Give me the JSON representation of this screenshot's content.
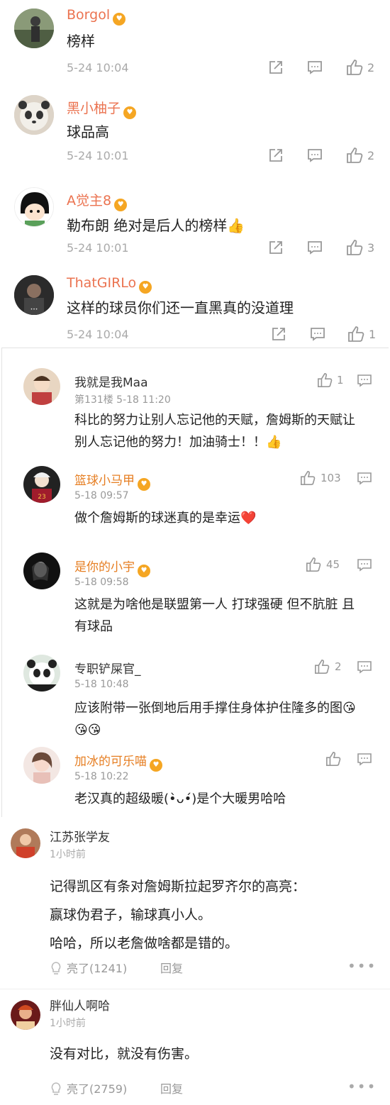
{
  "weibo": {
    "comments": [
      {
        "user": "Borgol",
        "text": "榜样",
        "time": "5-24 10:04",
        "likes": "2"
      },
      {
        "user": "黑小柚子",
        "text": "球品高",
        "time": "5-24 10:01",
        "likes": "2"
      },
      {
        "user": "A觉主8",
        "text": "勒布朗 绝对是后人的榜样👍",
        "time": "5-24 10:01",
        "likes": "3"
      },
      {
        "user": "ThatGIRLo",
        "text": "这样的球员你们还一直黑真的没道理",
        "time": "5-24 10:04",
        "likes": "1"
      }
    ]
  },
  "tieba": {
    "comments": [
      {
        "user": "我就是我Maa",
        "meta": "第131楼 5-18 11:20",
        "text": "科比的努力让别人忘记他的天赋，詹姆斯的天赋让别人忘记他的努力！加油骑士！！👍",
        "likes": "1"
      },
      {
        "user": "篮球小马甲",
        "meta": "5-18 09:57",
        "text": "做个詹姆斯的球迷真的是幸运❤️",
        "likes": "103"
      },
      {
        "user": "是你的小宇",
        "meta": "5-18 09:58",
        "text": "这就是为啥他是联盟第一人 打球强硬 但不肮脏 且有球品",
        "likes": "45"
      },
      {
        "user": "专职铲屎官_",
        "meta": "5-18 10:48",
        "text": "应该附带一张倒地后用手撑住身体护住隆多的图😘😘😘",
        "likes": "2"
      },
      {
        "user": "加冰的可乐喵",
        "meta": "5-18 10:22",
        "text": "老汉真的超级暖(•̀ᴗ•́)是个大暖男哈哈",
        "likes": ""
      }
    ]
  },
  "hupu": {
    "comments": [
      {
        "user": "江苏张学友",
        "time": "1小时前",
        "lines": [
          "记得凯区有条对詹姆斯拉起罗齐尔的高亮：",
          "赢球伪君子，输球真小人。",
          "哈哈，所以老詹做啥都是错的。"
        ],
        "light": "亮了(1241)",
        "reply": "回复",
        "more": "•••"
      },
      {
        "user": "胖仙人啊哈",
        "time": "1小时前",
        "lines": [
          "没有对比，就没有伤害。"
        ],
        "light": "亮了(2759)",
        "reply": "回复",
        "more": "•••"
      }
    ]
  }
}
